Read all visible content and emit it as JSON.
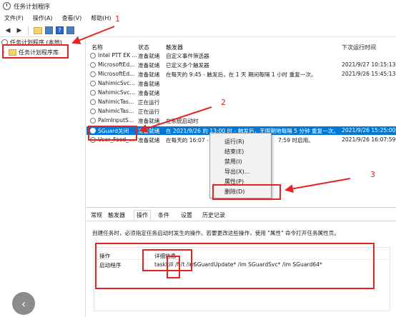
{
  "window": {
    "title": "任务计划程序"
  },
  "menu": [
    "文件(F)",
    "操作(A)",
    "查看(V)",
    "帮助(H)"
  ],
  "toolbar": {
    "help_glyph": "?"
  },
  "tree": {
    "root": "任务计划程序 (本地)",
    "child": "任务计划程序库"
  },
  "columns": {
    "name": "名称",
    "status": "状态",
    "trigger": "触发器",
    "next_run": "下次运行时间"
  },
  "tasks": [
    {
      "name": "Intel PTT EK ...",
      "status": "准备就绪",
      "trigger": "自定义事件筛选器",
      "next": ""
    },
    {
      "name": "MicrosoftEd...",
      "status": "准备就绪",
      "trigger": "已定义多个触发器",
      "next": "2021/9/27 10:15:13"
    },
    {
      "name": "MicrosoftEd...",
      "status": "准备就绪",
      "trigger": "在每天的 9:45 - 触发后，在 1 天 期间每隔 1 小时 重复一次。",
      "next": "2021/9/26 15:45:13"
    },
    {
      "name": "NahimicSvc...",
      "status": "准备就绪",
      "trigger": "",
      "next": ""
    },
    {
      "name": "NahimicSvc...",
      "status": "准备就绪",
      "trigger": "",
      "next": ""
    },
    {
      "name": "NahimicTas...",
      "status": "正在运行",
      "trigger": "",
      "next": ""
    },
    {
      "name": "NahimicTas...",
      "status": "正在运行",
      "trigger": "",
      "next": ""
    },
    {
      "name": "PalmInputS...",
      "status": "准备就绪",
      "trigger": "在系统启动时",
      "next": ""
    },
    {
      "name": "SGuard关闭",
      "status": "准备就绪",
      "trigger": "在 2021/9/26 的 13:00 时 - 触发后，无限期地每隔 5 分钟 重复一次。",
      "next": "2021/9/26 15:25:00"
    },
    {
      "name": "User_Feed_...",
      "status": "准备就绪",
      "trigger": "在每天的 16:07 -",
      "next": "2021/9/26 16:07:59"
    }
  ],
  "context_menu": [
    "运行(R)",
    "结束(E)",
    "禁用(I)",
    "导出(X)...",
    "属性(P)",
    "删除(D)"
  ],
  "obscured_fragment": "7:59 时启用。",
  "tabs": [
    "常规",
    "触发器",
    "操作",
    "条件",
    "设置",
    "历史记录"
  ],
  "actions_panel": {
    "description": "创建任务时，必须指定任务启动时发生的操作。若要更改这些操作，使用 \"属性\" 命令打开任务属性页。",
    "header_action": "操作",
    "header_detail": "详细信息",
    "action_type": "启动程序",
    "command": "taskkill /f /t /im",
    "args": "SGuardUpdate* /im SGuardSvc* /im SGuard64*"
  },
  "annotations": [
    "1",
    "2",
    "3"
  ],
  "colors": {
    "selection": "#0078d7",
    "annotation": "#e32424"
  }
}
